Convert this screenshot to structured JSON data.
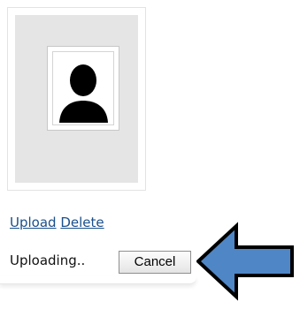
{
  "links": {
    "upload": "Upload",
    "delete": "Delete"
  },
  "status": {
    "text": "Uploading..",
    "cancel_label": "Cancel"
  },
  "colors": {
    "link": "#1a4f8b",
    "arrow_fill": "#4f86c6",
    "photo_bg": "#e5e5e5"
  },
  "icons": {
    "avatar": "person-silhouette-icon",
    "pointer": "arrow-left-icon"
  }
}
